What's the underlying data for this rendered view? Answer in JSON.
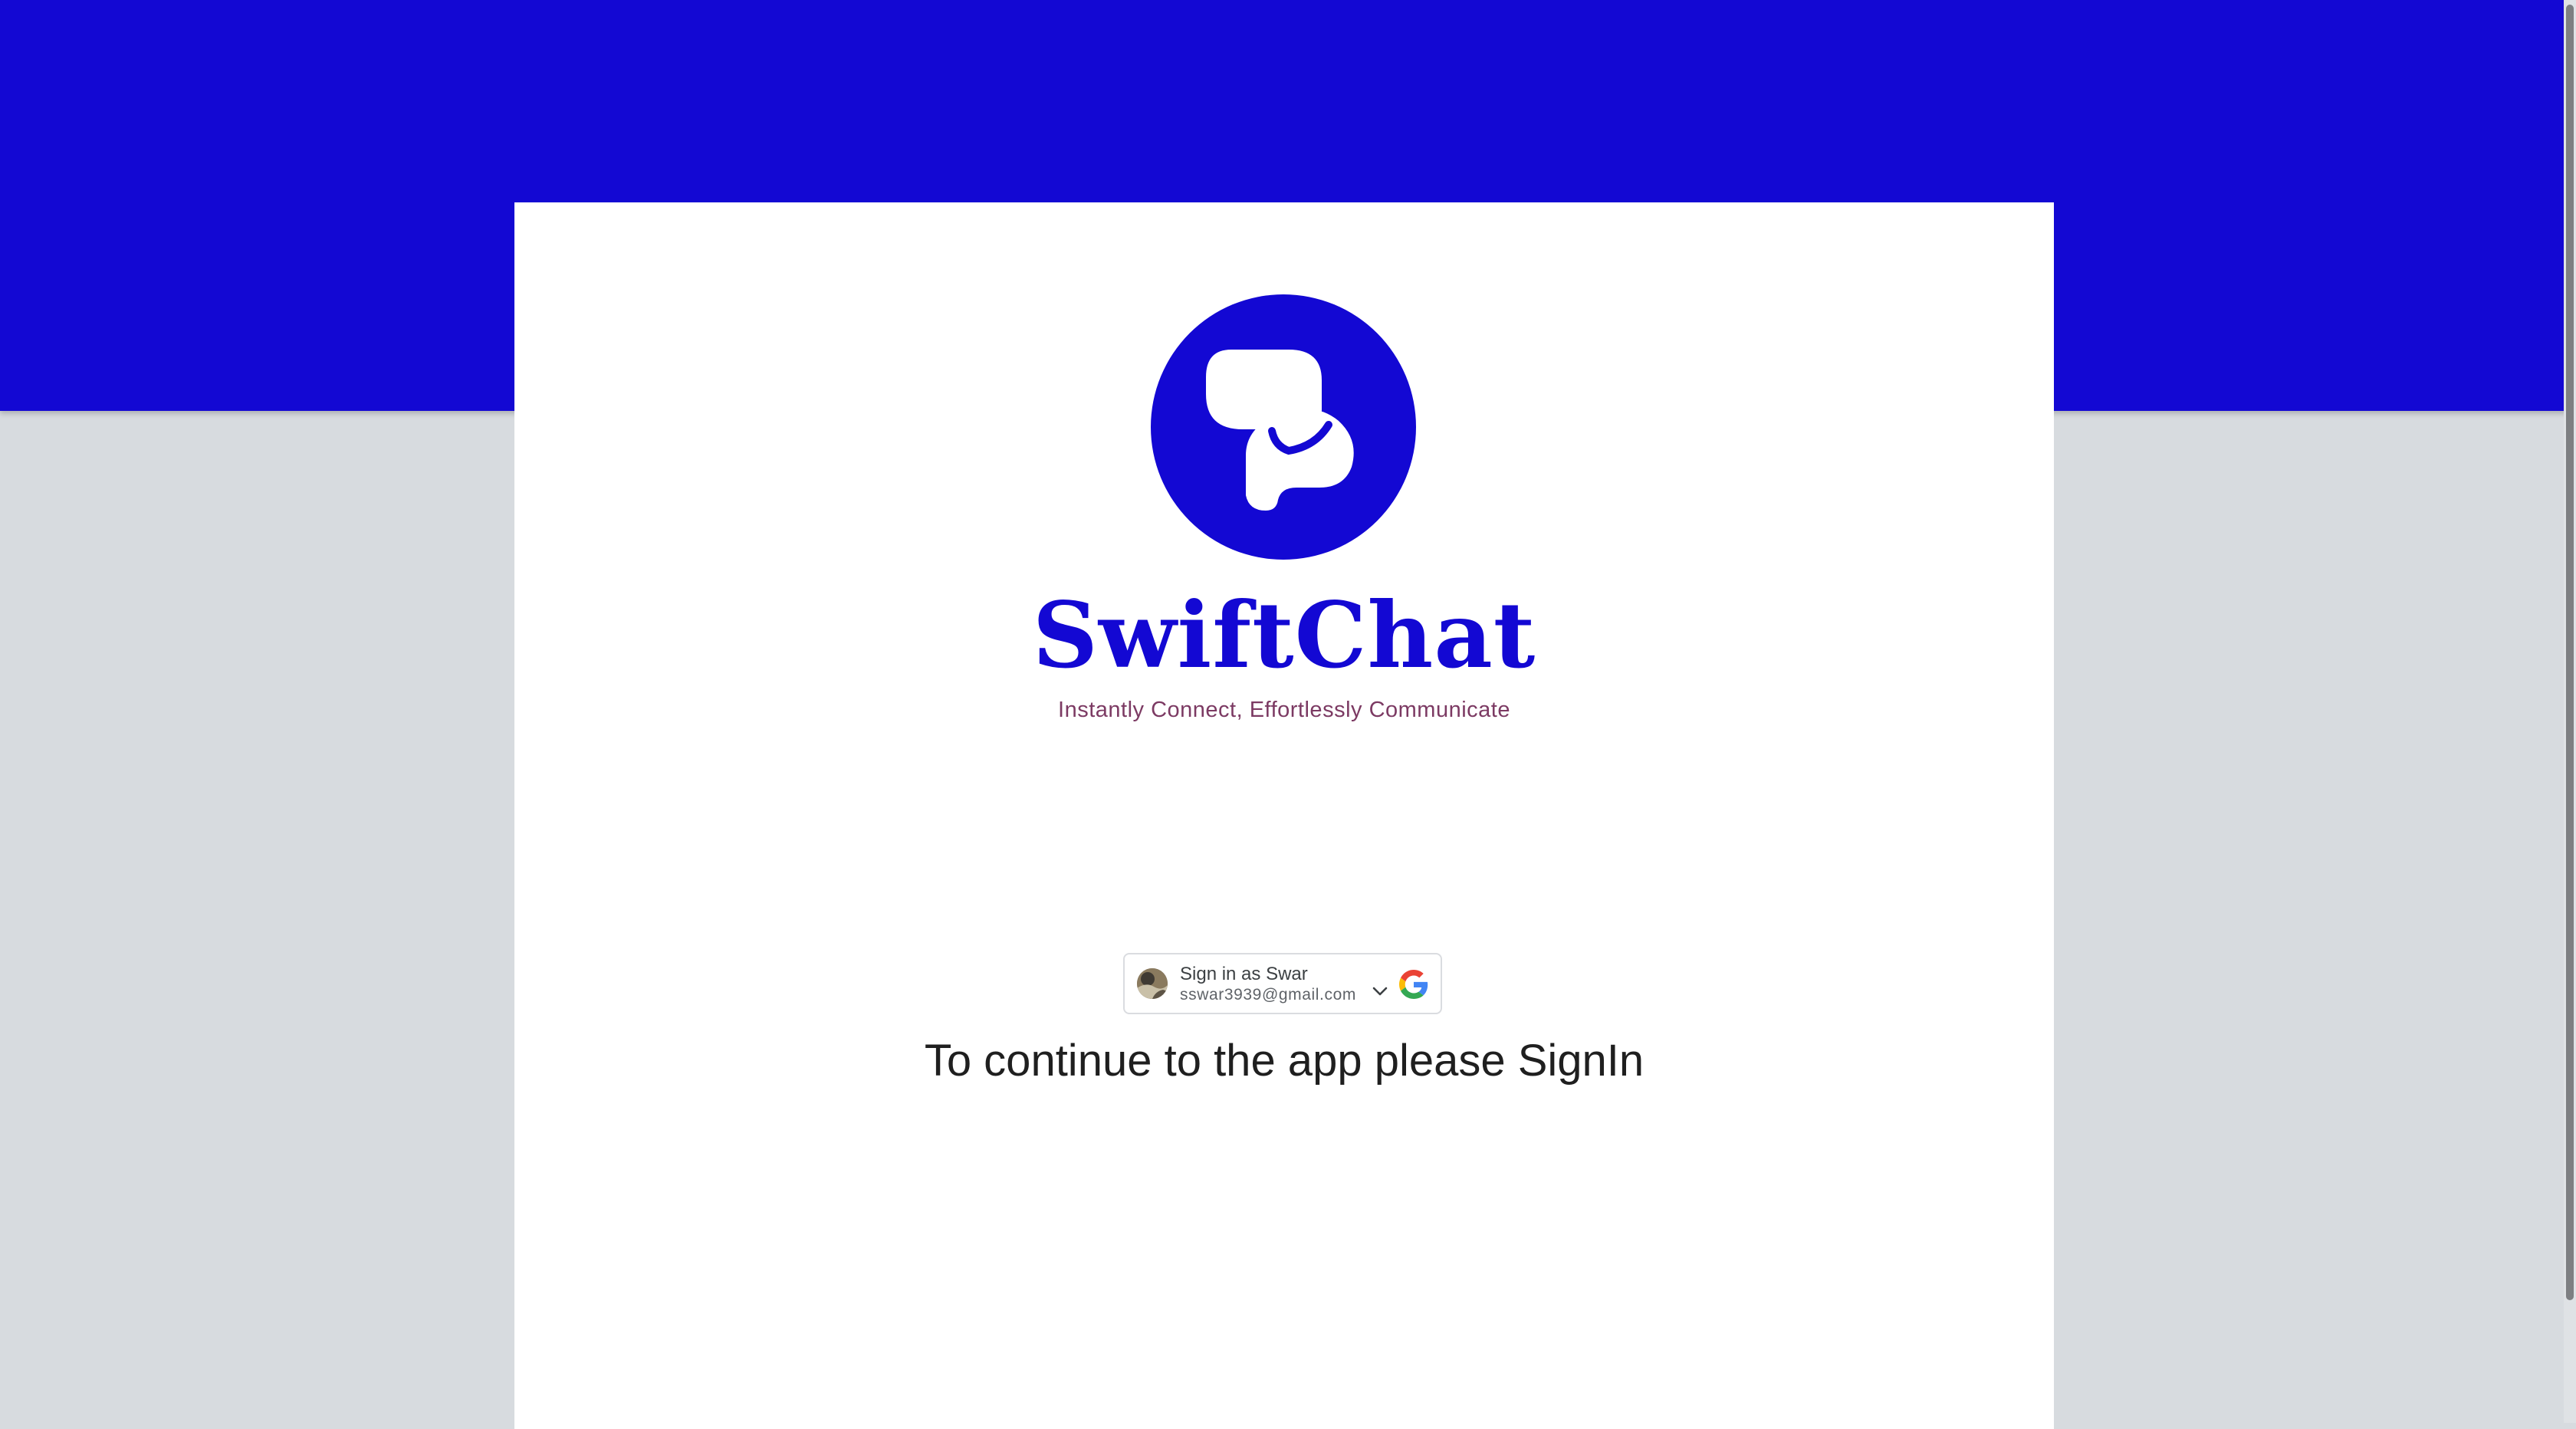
{
  "app": {
    "brand_name": "SwiftChat",
    "tagline": "Instantly Connect, Effortlessly Communicate",
    "prompt": "To continue to the app please SignIn"
  },
  "google_signin": {
    "title": "Sign in as Swar",
    "email": "sswar3939@gmail.com",
    "avatar_icon": "user-avatar",
    "chevron_icon": "chevron-down-icon",
    "brand_icon": "google-g-logo"
  },
  "colors": {
    "brand_blue": "#1308d3",
    "tagline": "#7c3a63",
    "background": "#d7dbdf"
  }
}
